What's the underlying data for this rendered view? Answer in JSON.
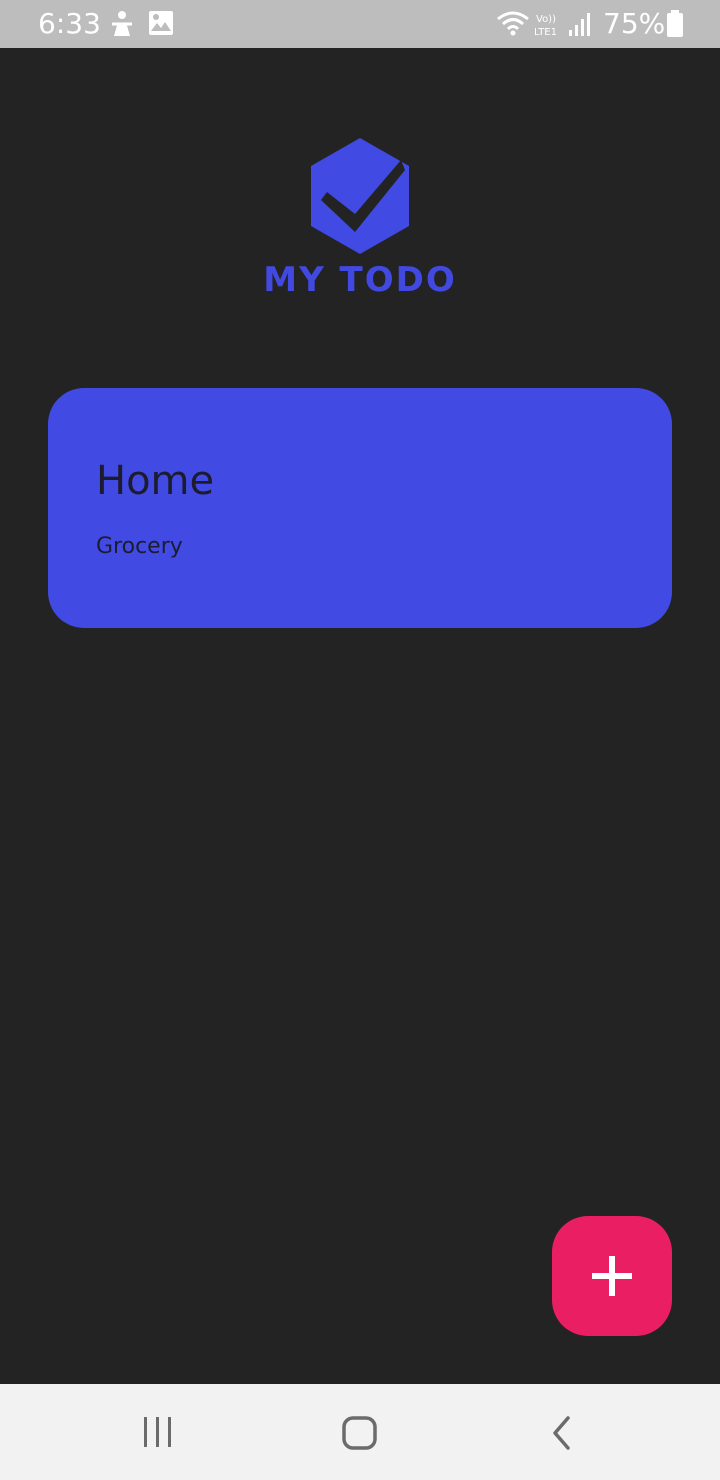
{
  "status_bar": {
    "time": "6:33",
    "battery_percent": "75%",
    "icons": [
      "accessibility-icon",
      "image-icon",
      "wifi-icon",
      "volte-icon",
      "signal-icon",
      "battery-icon"
    ],
    "volte_label": "Vo)) LTE1"
  },
  "app": {
    "logo_text": "MY TODO",
    "accent_color": "#414be3",
    "fab_color": "#e91e63"
  },
  "lists": [
    {
      "title": "Home",
      "subtitle": "Grocery"
    }
  ],
  "fab": {
    "icon": "plus-icon"
  },
  "nav_bar": {
    "buttons": [
      "recent-apps-icon",
      "home-icon",
      "back-icon"
    ]
  }
}
